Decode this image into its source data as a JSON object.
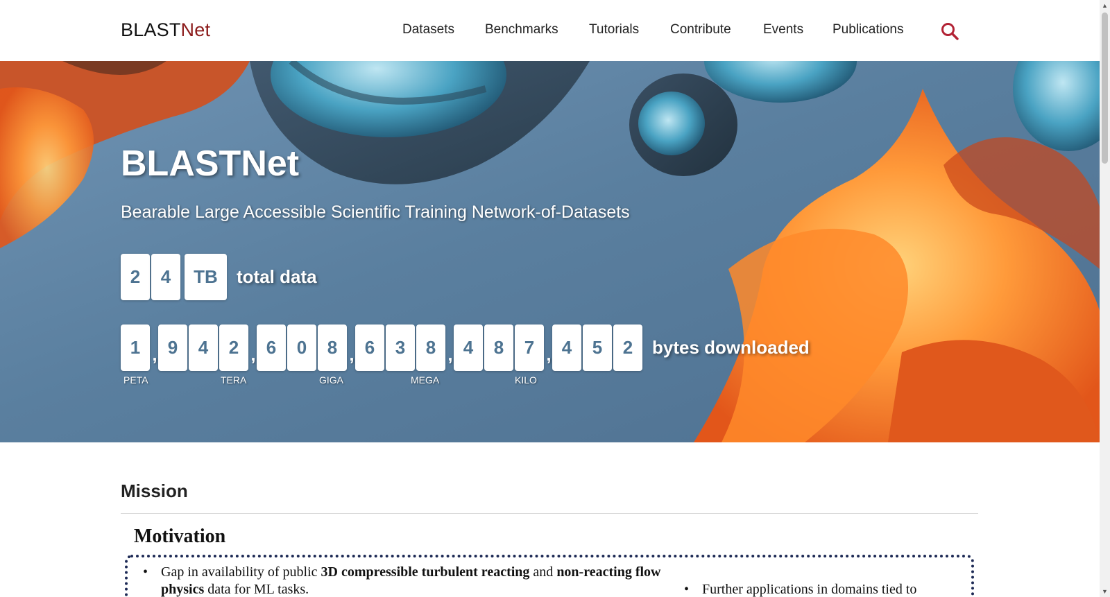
{
  "brand": {
    "part1": "BLAST",
    "part2": "Net"
  },
  "nav": {
    "items": [
      {
        "label": "Datasets"
      },
      {
        "label": "Benchmarks"
      },
      {
        "label": "Tutorials"
      },
      {
        "label": "Contribute"
      },
      {
        "label": "Events"
      },
      {
        "label": "Publications"
      }
    ],
    "search_icon": "search-icon"
  },
  "hero": {
    "title": "BLASTNet",
    "subtitle": "Bearable Large Accessible Scientific Training Network-of-Datasets",
    "total": {
      "digits": [
        "2",
        "4"
      ],
      "unit": "TB",
      "label": "total data"
    },
    "bytes": {
      "groups": [
        [
          "1"
        ],
        [
          "9",
          "4",
          "2"
        ],
        [
          "6",
          "0",
          "8"
        ],
        [
          "6",
          "3",
          "8"
        ],
        [
          "4",
          "8",
          "7"
        ],
        [
          "4",
          "5",
          "2"
        ]
      ],
      "separator": ",",
      "label": "bytes downloaded",
      "magnitudes": [
        "PETA",
        "TERA",
        "GIGA",
        "MEGA",
        "KILO"
      ]
    }
  },
  "content": {
    "mission_heading": "Mission",
    "motivation_heading": "Motivation",
    "bullets": [
      {
        "pre": "Gap in availability of public ",
        "bold1": "3D compressible turbulent reacting",
        "mid": " and ",
        "bold2": "non-reacting flow physics",
        "post": " data for ML tasks."
      },
      {
        "text": "Further applications in domains tied to"
      }
    ]
  },
  "colors": {
    "brand_accent": "#8b1a1a",
    "tile_text": "#4d7391",
    "box_border": "#1d2a55",
    "search": "#b22234"
  }
}
